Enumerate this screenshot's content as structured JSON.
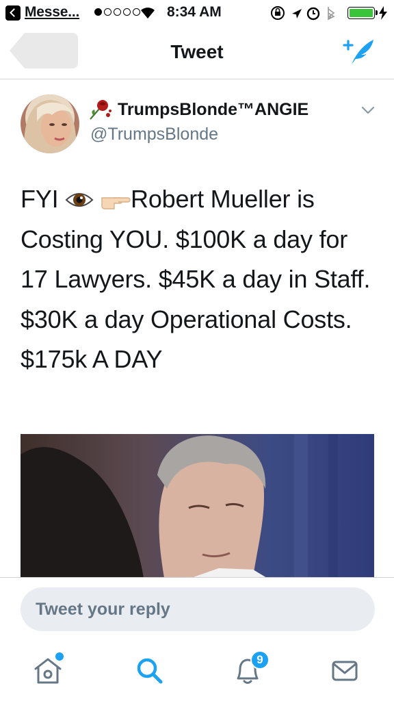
{
  "status_bar": {
    "back_app": "Messe...",
    "time": "8:34 AM",
    "signal_bars": 1,
    "battery_level": 1.0
  },
  "nav": {
    "title": "Tweet",
    "compose_icon": "compose-tweet-icon"
  },
  "tweet": {
    "display_name": "TrumpsBlonde™ANGIE",
    "handle": "@TrumpsBlonde",
    "text_segments": {
      "prefix": "FYI ",
      "main": "Robert Mueller is Costing YOU. $100K a day for 17 Lawyers. $45K a day in Staff. $30K a day Operational Costs. $175k A DAY"
    }
  },
  "reply": {
    "placeholder": "Tweet your reply"
  },
  "tabs": {
    "items": [
      "home-icon",
      "search-icon",
      "notifications-icon",
      "messages-icon"
    ],
    "notification_count": "9"
  },
  "colors": {
    "accent": "#1da1f2",
    "text": "#14171a",
    "secondary": "#657786",
    "input_bg": "#e9edf1"
  }
}
